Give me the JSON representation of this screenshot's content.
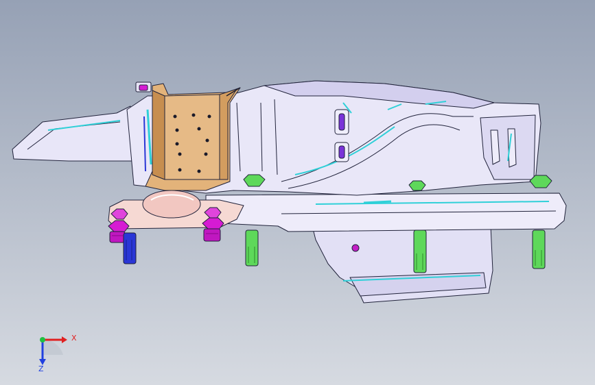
{
  "viewport": {
    "background_top": "#96a1b5",
    "background_bottom": "#d6dae1"
  },
  "colors": {
    "part_body": "#eceaf9",
    "part_shade": "#cfcbea",
    "part_dark": "#b9b4dc",
    "edge": "#20223a",
    "bracket_orange": "#e3b37a",
    "bracket_dark": "#c78e4f",
    "mount_pink": "#f4cdc6",
    "bolt_green": "#5ed85a",
    "bolt_magenta": "#d61bd3",
    "stud_blue": "#2a36d6",
    "accent_cyan": "#2fd0d8",
    "accent_purple": "#7a33d9"
  },
  "triad": {
    "x_label": "X",
    "z_label": "Z",
    "x_color": "#e02020",
    "y_color": "#20c040",
    "z_color": "#2040e0"
  }
}
